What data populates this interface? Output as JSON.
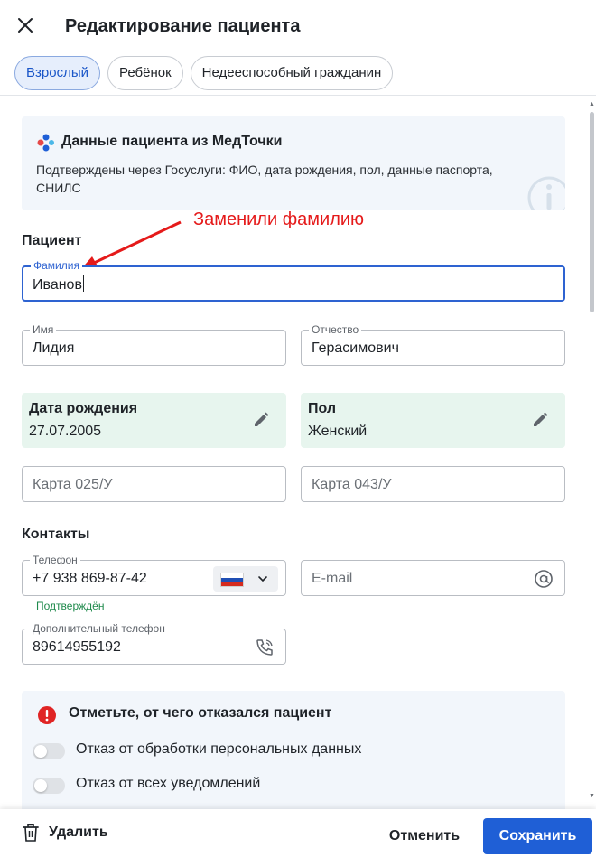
{
  "header": {
    "title": "Редактирование пациента",
    "close_icon": "close-icon"
  },
  "tabs": [
    {
      "label": "Взрослый",
      "active": true
    },
    {
      "label": "Ребёнок",
      "active": false
    },
    {
      "label": "Недееспособный гражданин",
      "active": false
    }
  ],
  "info_card": {
    "title": "Данные пациента из МедТочки",
    "text": "Подтверждены через Госуслуги: ФИО, дата рождения, пол, данные паспорта, СНИЛС"
  },
  "annotation": {
    "text": "Заменили фамилию",
    "color": "#e51a1a"
  },
  "patient": {
    "section_title": "Пациент",
    "surname": {
      "label": "Фамилия",
      "value": "Иванов"
    },
    "name": {
      "label": "Имя",
      "value": "Лидия"
    },
    "patronymic": {
      "label": "Отчество",
      "value": "Герасимович"
    },
    "birth_date": {
      "label": "Дата рождения",
      "value": "27.07.2005"
    },
    "gender": {
      "label": "Пол",
      "value": "Женский"
    },
    "card_025": {
      "placeholder": "Карта 025/У"
    },
    "card_043": {
      "placeholder": "Карта 043/У"
    }
  },
  "contacts": {
    "section_title": "Контакты",
    "phone": {
      "label": "Телефон",
      "value": "+7 938 869-87-42",
      "status": "Подтверждён",
      "country": "RU"
    },
    "email": {
      "placeholder": "E-mail"
    },
    "extra_phone": {
      "label": "Дополнительный телефон",
      "value": "89614955192"
    }
  },
  "refusal": {
    "title": "Отметьте, от чего отказался пациент",
    "options": [
      {
        "label": "Отказ от обработки персональных данных",
        "on": false
      },
      {
        "label": "Отказ от всех уведомлений",
        "on": false
      }
    ]
  },
  "footer": {
    "delete_label": "Удалить",
    "cancel_label": "Отменить",
    "save_label": "Сохранить"
  },
  "colors": {
    "accent": "#1f5fd6",
    "readonly_bg": "#e7f5ee",
    "card_bg": "#f2f6fb",
    "verified": "#1f8a4c",
    "alert": "#e02424"
  }
}
